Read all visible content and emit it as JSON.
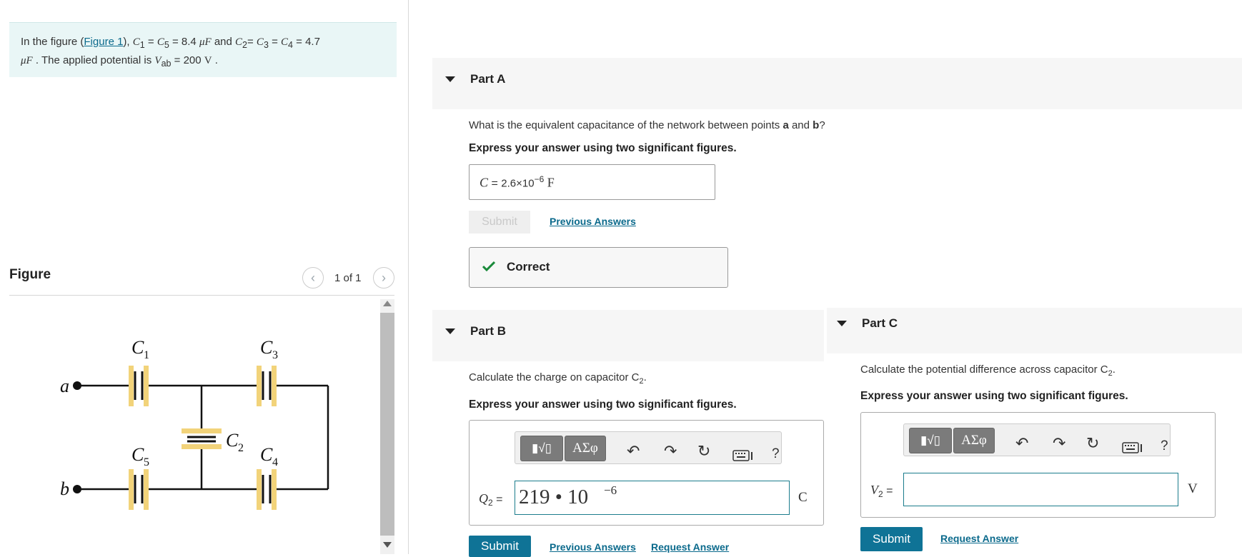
{
  "problem": {
    "intro": "In the figure (",
    "figure_link": "Figure 1",
    "close_paren": "),",
    "c1": "C",
    "c1_sub": "1",
    "eq1": "=",
    "c5": "C",
    "c5_sub": "5",
    "val1": "= 8.4",
    "unit1": "μF",
    "and": "and",
    "c2": "C",
    "c2_sub": "2",
    "c3": "C",
    "c3_sub": "3",
    "c4": "C",
    "c4_sub": "4",
    "val2": "= 4.7",
    "unit2": "μF",
    "applied": ". The applied potential is",
    "vab": "V",
    "vab_sub": "ab",
    "val3": "= 200",
    "unit3": "V",
    "period": "."
  },
  "figure": {
    "title": "Figure",
    "counter": "1 of 1",
    "prev": "‹",
    "next": "›",
    "labels": {
      "c1": "C",
      "c1_sub": "1",
      "c3": "C",
      "c3_sub": "3",
      "c2": "C",
      "c2_sub": "2",
      "c5": "C",
      "c5_sub": "5",
      "c4": "C",
      "c4_sub": "4",
      "a": "a",
      "b": "b"
    }
  },
  "part_a": {
    "title": "Part A",
    "question_pre": "What is the equivalent capacitance of the network between points ",
    "question_a": "a",
    "question_and": " and ",
    "question_b": "b",
    "question_end": "?",
    "instruction": "Express your answer using two significant figures.",
    "answer_var": "C",
    "answer_eq": "=",
    "answer_val": "2.6×10",
    "answer_exp": "−6",
    "answer_unit": "F",
    "submit": "Submit",
    "previous_answers": "Previous Answers",
    "feedback": "Correct",
    "feedback_icon": "checkmark-icon"
  },
  "part_b": {
    "title": "Part B",
    "question": "Calculate the charge on capacitor C",
    "question_sub": "2",
    "question_end": ".",
    "instruction": "Express your answer using two significant figures.",
    "var": "Q",
    "var_sub": "2",
    "eq": "=",
    "input_value": "219 • 10",
    "input_exp": "−6",
    "unit": "C",
    "toolbar": {
      "templates": "▮√▯",
      "symbols": "ΑΣφ",
      "help": "?"
    },
    "submit": "Submit",
    "previous_answers": "Previous Answers",
    "request_answer": "Request Answer"
  },
  "part_c": {
    "title": "Part C",
    "question": "Calculate the potential difference across capacitor C",
    "question_sub": "2",
    "question_end": ".",
    "instruction": "Express your answer using two significant figures.",
    "var": "V",
    "var_sub": "2",
    "eq": "=",
    "input_value": "",
    "unit": "V",
    "toolbar": {
      "templates": "▮√▯",
      "symbols": "ΑΣφ",
      "help": "?"
    },
    "submit": "Submit",
    "request_answer": "Request Answer"
  },
  "colors": {
    "accent": "#0f7396",
    "link": "#0b6a8c",
    "capacitor_plate": "#f2d37a",
    "problem_bg": "#e9f6f6",
    "correct": "#1a8a3a"
  }
}
